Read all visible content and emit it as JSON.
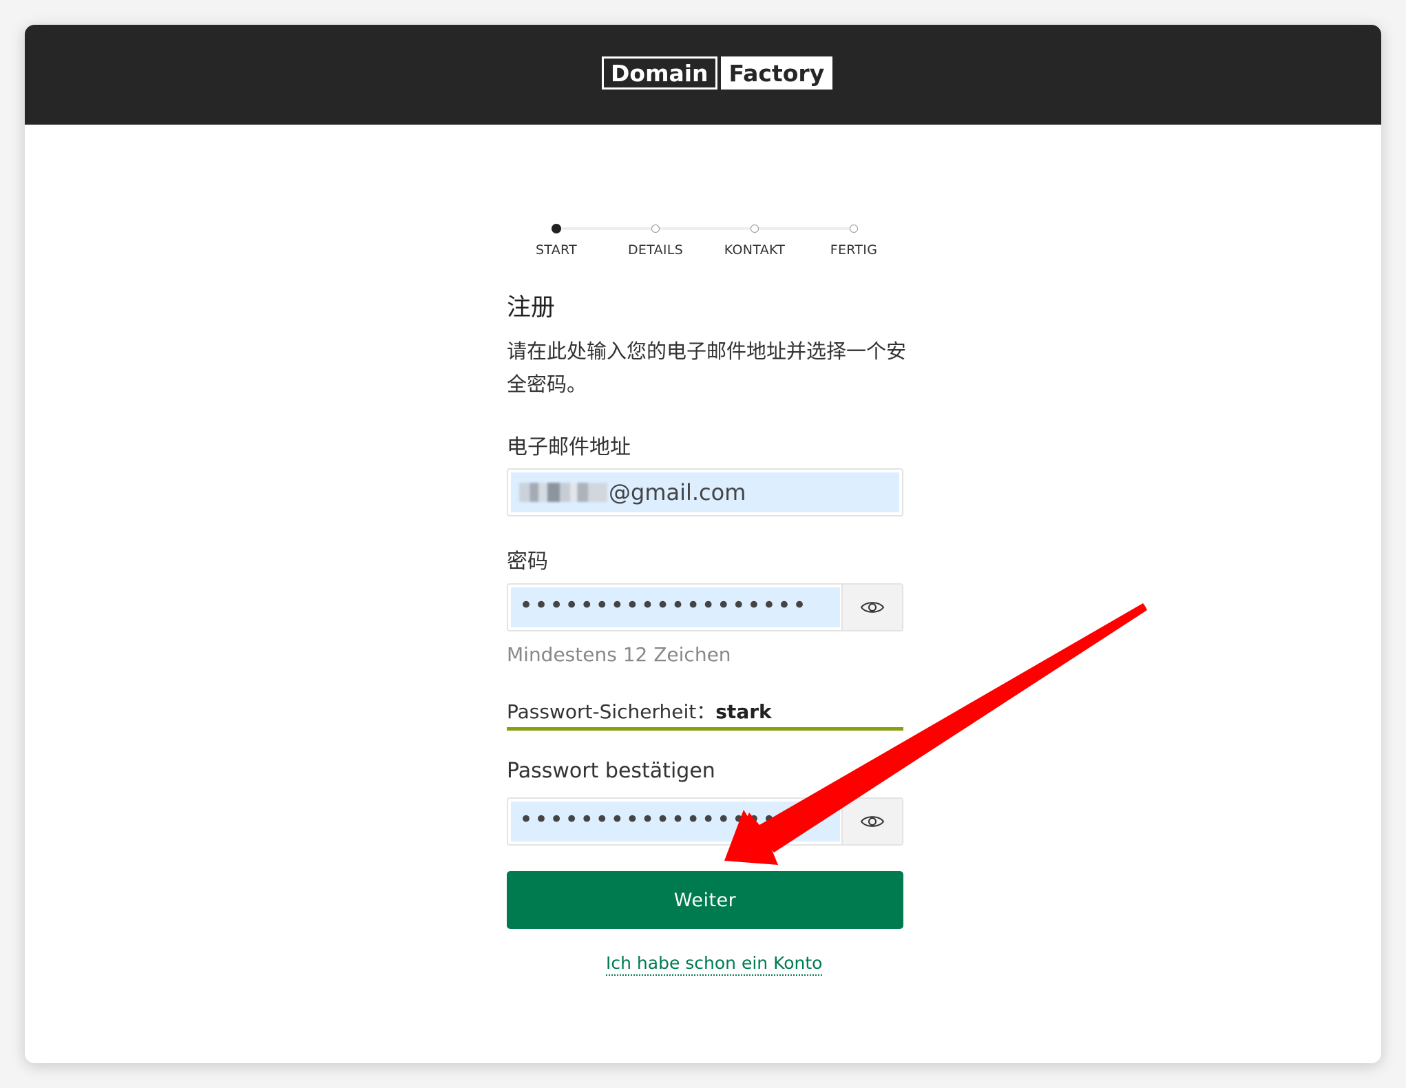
{
  "header": {
    "logo_left": "Domain",
    "logo_right": "Factory"
  },
  "stepper": {
    "steps": [
      {
        "label": "START",
        "active": true
      },
      {
        "label": "DETAILS",
        "active": false
      },
      {
        "label": "KONTAKT",
        "active": false
      },
      {
        "label": "FERTIG",
        "active": false
      }
    ]
  },
  "form": {
    "title": "注册",
    "intro": "请在此处输入您的电子邮件地址并选择一个安全密码。",
    "email": {
      "label": "电子邮件地址",
      "value": "@gmail.com"
    },
    "password": {
      "label": "密码",
      "value": "•••••••••••••••••••",
      "hint": "Mindestens 12 Zeichen"
    },
    "strength": {
      "label": "Passwort-Sicherheit：",
      "value": "stark",
      "color": "#86a012"
    },
    "confirm": {
      "label": "Passwort bestätigen",
      "value": "•••••••••••••••••••"
    },
    "submit_label": "Weiter",
    "login_link": "Ich habe schon ein Konto"
  },
  "colors": {
    "header_bg": "#262626",
    "accent": "#007b4f",
    "input_autofill": "#ddeeff",
    "annotation_arrow": "#ff0000"
  },
  "icons": {
    "reveal_password": "eye-icon"
  }
}
